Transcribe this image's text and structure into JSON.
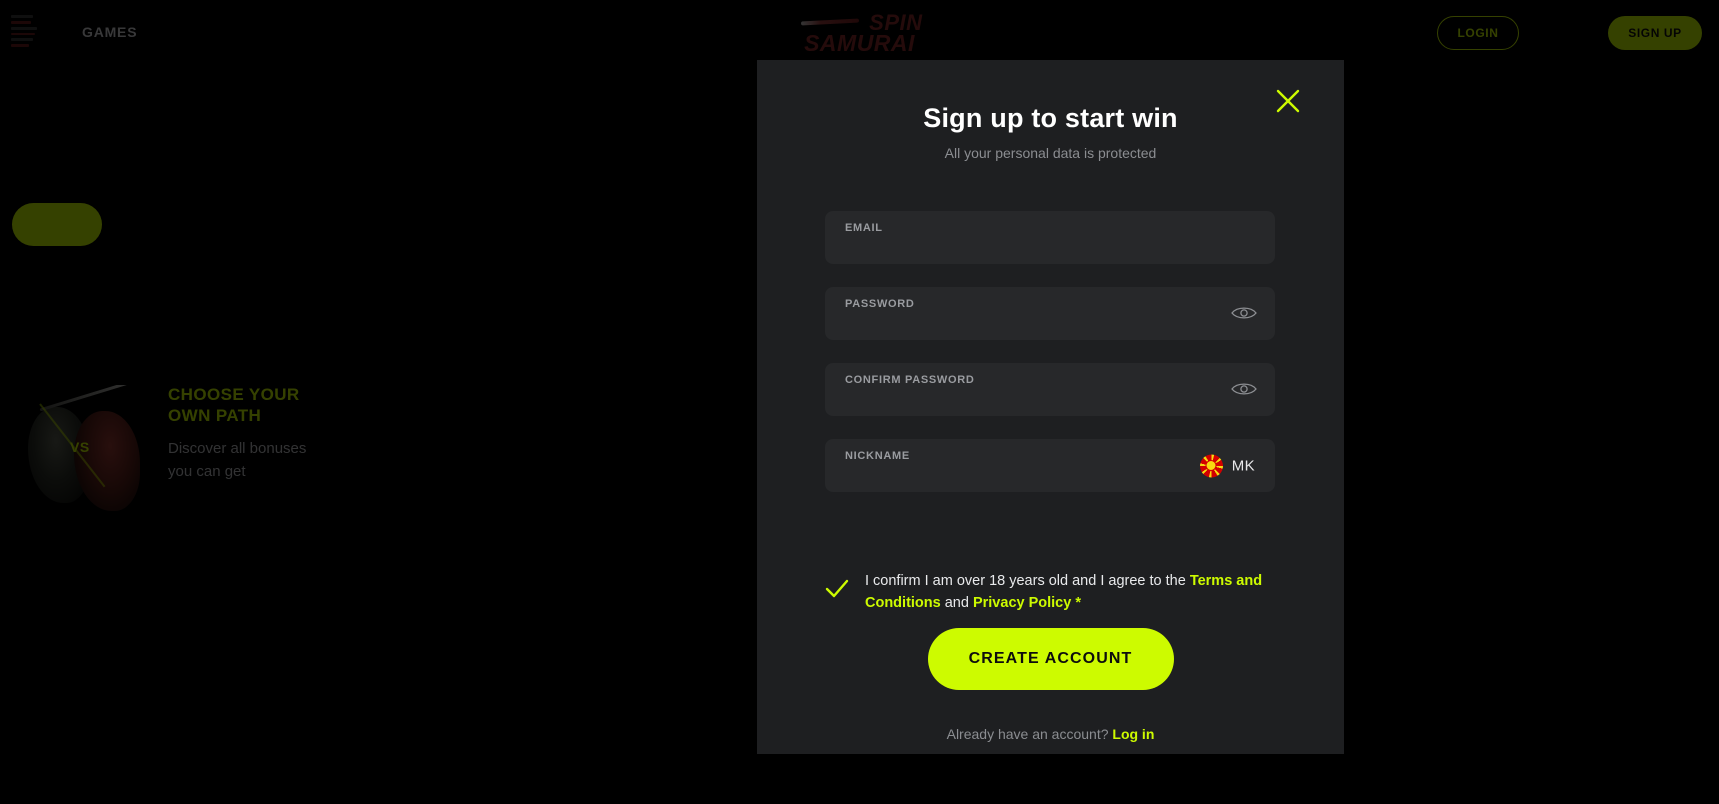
{
  "header": {
    "menu_icon": "hamburger-menu-icon",
    "nav_games": "GAMES",
    "logo_line1": "SPIN",
    "logo_line2": "SAMURAI",
    "login_label": "LOGIN",
    "signup_label": "SIGN UP"
  },
  "promo": {
    "title": "CHOOSE YOUR OWN PATH",
    "subtitle": "Discover all bonuses you can get",
    "vs_label": "VS"
  },
  "modal": {
    "title": "Sign up to start win",
    "subtitle": "All your personal data is protected",
    "close_icon": "close-icon",
    "fields": [
      {
        "name": "email",
        "label": "EMAIL",
        "value": "",
        "placeholder": ""
      },
      {
        "name": "password",
        "label": "PASSWORD",
        "value": "",
        "placeholder": "",
        "toggle_icon": "eye-icon"
      },
      {
        "name": "confirm_password",
        "label": "CONFIRM PASSWORD",
        "value": "",
        "placeholder": "",
        "toggle_icon": "eye-icon"
      },
      {
        "name": "nickname",
        "label": "NICKNAME",
        "value": "",
        "placeholder": ""
      }
    ],
    "country": {
      "code": "MK",
      "flag_icon": "flag-mk-icon"
    },
    "agreement": {
      "checked": true,
      "text_before": "I confirm I am over 18 years old and I agree to the ",
      "terms_link": "Terms and Conditions",
      "text_middle": " and ",
      "privacy_link": "Privacy Policy",
      "required_mark": " *"
    },
    "submit_label": "CREATE ACCOUNT",
    "login_hint_text": "Already have an account? ",
    "login_hint_link": "Log in"
  },
  "colors": {
    "accent": "#cdfb00",
    "modal_bg": "#1e1f21",
    "field_bg": "#27282a",
    "page_bg": "#000000",
    "muted_text": "#8b8d91",
    "logo_red": "#8e2a2a"
  }
}
